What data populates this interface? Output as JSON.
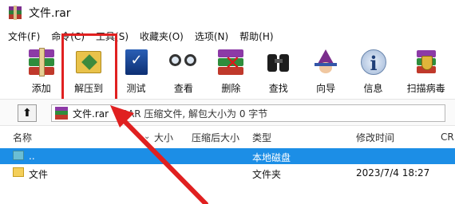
{
  "window": {
    "title": "文件.rar"
  },
  "menu": [
    "文件(F)",
    "命令(C)",
    "工具(S)",
    "收藏夹(O)",
    "选项(N)",
    "帮助(H)"
  ],
  "toolbar": {
    "add": "添加",
    "extract_to": "解压到",
    "test": "测试",
    "view": "查看",
    "delete": "删除",
    "find": "查找",
    "wizard": "向导",
    "info": "信息",
    "scan": "扫描病毒"
  },
  "address": {
    "file": "文件.rar",
    "description": "- RAR 压缩文件, 解包大小为 0 字节"
  },
  "columns": {
    "name": "名称",
    "size": "大小",
    "packed": "压缩后大小",
    "type": "类型",
    "modified": "修改时间",
    "crc": "CR"
  },
  "files": [
    {
      "name": "..",
      "type": "本地磁盘",
      "modified": ""
    },
    {
      "name": "文件",
      "type": "文件夹",
      "modified": "2023/7/4 18:27"
    }
  ],
  "colors": {
    "selection": "#1c8ee6",
    "annotation": "#e02020"
  }
}
